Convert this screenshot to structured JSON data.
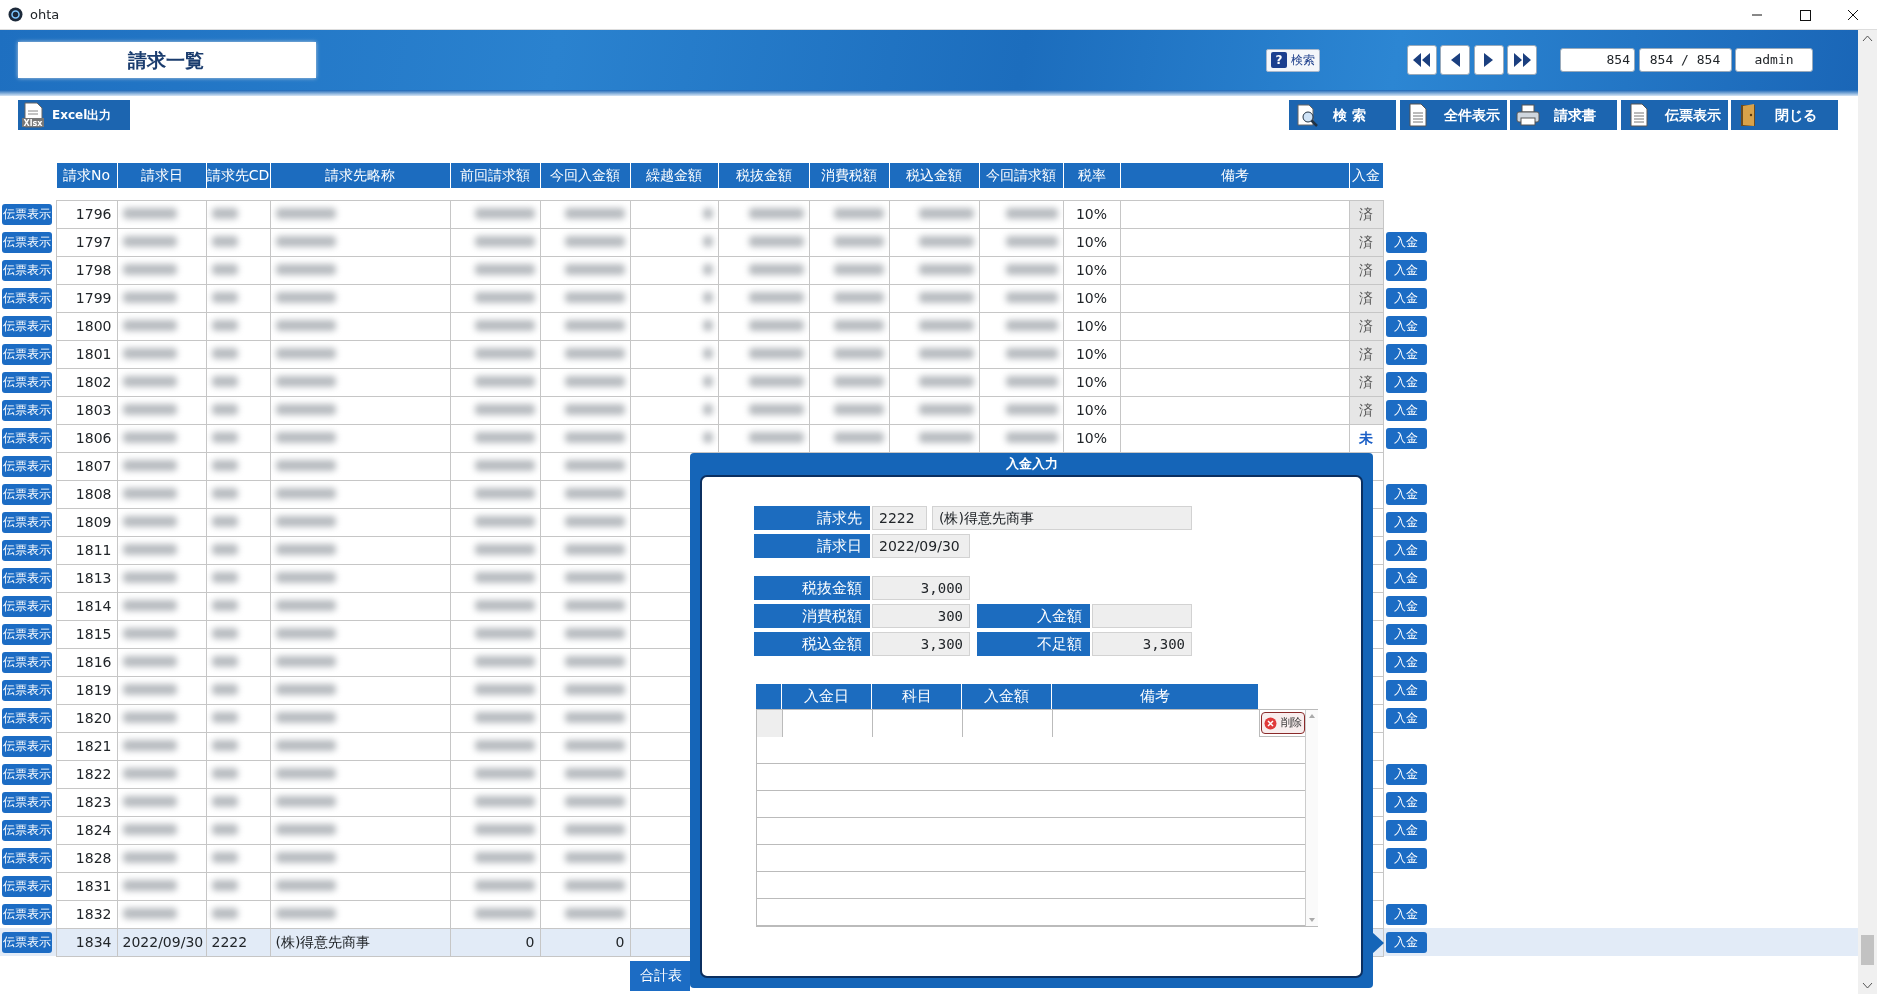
{
  "window": {
    "title": "ohta"
  },
  "header": {
    "title": "請求一覧",
    "help_icon": "?",
    "help_button": "検索",
    "record_field": "854",
    "record_count": "854 / 854",
    "user": "admin"
  },
  "toolbar": {
    "export_button": {
      "label": "Excel出力",
      "icon_label": "Xlsx"
    },
    "buttons": [
      {
        "label": "検 索",
        "kind": "search"
      },
      {
        "label": "全件表示",
        "kind": "document"
      },
      {
        "label": "請求書",
        "kind": "printer"
      },
      {
        "label": "伝票表示",
        "kind": "document"
      },
      {
        "label": "閉じる",
        "kind": "door"
      }
    ]
  },
  "table": {
    "columns": [
      "請求No",
      "請求日",
      "請求先CD",
      "請求先略称",
      "前回請求額",
      "今回入金額",
      "繰越金額",
      "税抜金額",
      "消費税額",
      "税込金額",
      "今回請求額",
      "税率",
      "備考",
      "入金"
    ],
    "rows": [
      {
        "slip_button": "伝票表示",
        "no": "1796",
        "masked": true,
        "tax_rate": "10%",
        "paid_status": "済",
        "settled": true,
        "selected": false
      },
      {
        "slip_button": "伝票表示",
        "no": "1797",
        "masked": true,
        "tax_rate": "10%",
        "paid_status": "済",
        "settled": true,
        "payment_button": "入金",
        "selected": false
      },
      {
        "slip_button": "伝票表示",
        "no": "1798",
        "masked": true,
        "tax_rate": "10%",
        "paid_status": "済",
        "settled": true,
        "payment_button": "入金",
        "selected": false
      },
      {
        "slip_button": "伝票表示",
        "no": "1799",
        "masked": true,
        "tax_rate": "10%",
        "paid_status": "済",
        "settled": true,
        "payment_button": "入金",
        "selected": false
      },
      {
        "slip_button": "伝票表示",
        "no": "1800",
        "masked": true,
        "tax_rate": "10%",
        "paid_status": "済",
        "settled": true,
        "payment_button": "入金",
        "selected": false
      },
      {
        "slip_button": "伝票表示",
        "no": "1801",
        "masked": true,
        "tax_rate": "10%",
        "paid_status": "済",
        "settled": true,
        "payment_button": "入金",
        "selected": false
      },
      {
        "slip_button": "伝票表示",
        "no": "1802",
        "masked": true,
        "tax_rate": "10%",
        "paid_status": "済",
        "settled": true,
        "payment_button": "入金",
        "selected": false
      },
      {
        "slip_button": "伝票表示",
        "no": "1803",
        "masked": true,
        "tax_rate": "10%",
        "paid_status": "済",
        "settled": true,
        "payment_button": "入金",
        "selected": false
      },
      {
        "slip_button": "伝票表示",
        "no": "1806",
        "masked": true,
        "tax_rate": "10%",
        "paid_status": "未",
        "settled": false,
        "payment_button": "入金",
        "selected": false
      },
      {
        "slip_button": "伝票表示",
        "no": "1807",
        "masked": true,
        "selected": false
      },
      {
        "slip_button": "伝票表示",
        "no": "1808",
        "masked": true,
        "payment_button": "入金",
        "selected": false
      },
      {
        "slip_button": "伝票表示",
        "no": "1809",
        "masked": true,
        "payment_button": "入金",
        "selected": false
      },
      {
        "slip_button": "伝票表示",
        "no": "1811",
        "masked": true,
        "payment_button": "入金",
        "selected": false
      },
      {
        "slip_button": "伝票表示",
        "no": "1813",
        "masked": true,
        "payment_button": "入金",
        "selected": false
      },
      {
        "slip_button": "伝票表示",
        "no": "1814",
        "masked": true,
        "payment_button": "入金",
        "selected": false
      },
      {
        "slip_button": "伝票表示",
        "no": "1815",
        "masked": true,
        "payment_button": "入金",
        "selected": false
      },
      {
        "slip_button": "伝票表示",
        "no": "1816",
        "masked": true,
        "payment_button": "入金",
        "selected": false
      },
      {
        "slip_button": "伝票表示",
        "no": "1819",
        "masked": true,
        "payment_button": "入金",
        "selected": false
      },
      {
        "slip_button": "伝票表示",
        "no": "1820",
        "masked": true,
        "payment_button": "入金",
        "selected": false
      },
      {
        "slip_button": "伝票表示",
        "no": "1821",
        "masked": true,
        "selected": false
      },
      {
        "slip_button": "伝票表示",
        "no": "1822",
        "masked": true,
        "payment_button": "入金",
        "selected": false
      },
      {
        "slip_button": "伝票表示",
        "no": "1823",
        "masked": true,
        "payment_button": "入金",
        "selected": false
      },
      {
        "slip_button": "伝票表示",
        "no": "1824",
        "masked": true,
        "payment_button": "入金",
        "selected": false
      },
      {
        "slip_button": "伝票表示",
        "no": "1828",
        "masked": true,
        "payment_button": "入金",
        "selected": false
      },
      {
        "slip_button": "伝票表示",
        "no": "1831",
        "masked": true,
        "selected": false
      },
      {
        "slip_button": "伝票表示",
        "no": "1832",
        "masked": true,
        "payment_button": "入金",
        "selected": false
      },
      {
        "slip_button": "伝票表示",
        "no": "1834",
        "date": "2022/09/30",
        "customer_cd": "2222",
        "customer_name": "(株)得意先商事",
        "prev_amount": "0",
        "paid_amount": "0",
        "payment_button": "入金",
        "selected": true
      }
    ]
  },
  "total_button": "合計表",
  "dialog": {
    "title": "入金入力",
    "customer": {
      "label": "請求先",
      "code": "2222",
      "name": "(株)得意先商事"
    },
    "billing_date": {
      "label": "請求日",
      "value": "2022/09/30"
    },
    "summary_rows": [
      [
        {
          "label": "税抜金額",
          "value": "3,000"
        }
      ],
      [
        {
          "label": "消費税額",
          "value": "300"
        },
        {
          "label": "入金額"
        }
      ],
      [
        {
          "label": "税込金額",
          "value": "3,300"
        },
        {
          "label": "不足額",
          "value": "3,300"
        }
      ]
    ],
    "grid": {
      "columns": [
        "入金日",
        "科目",
        "入金額",
        "備考"
      ],
      "delete_button": "削除"
    }
  }
}
